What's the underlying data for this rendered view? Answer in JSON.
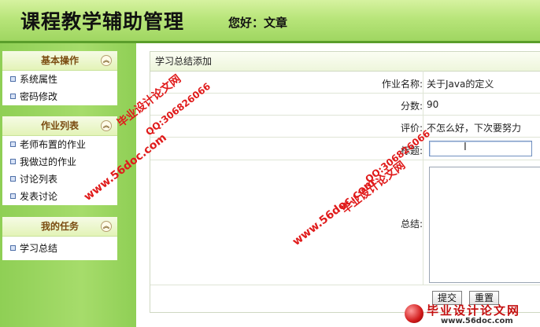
{
  "header": {
    "app_title": "课程教学辅助管理",
    "greeting": "您好：文章"
  },
  "sidebar": {
    "panels": [
      {
        "title": "基本操作",
        "items": [
          "系统属性",
          "密码修改"
        ]
      },
      {
        "title": "作业列表",
        "items": [
          "老师布置的作业",
          "我做过的作业",
          "讨论列表",
          "发表讨论"
        ]
      },
      {
        "title": "我的任务",
        "items": [
          "学习总结"
        ]
      }
    ]
  },
  "form": {
    "title": "学习总结添加",
    "rows": [
      {
        "label": "作业名称:",
        "value": "关于Java的定义"
      },
      {
        "label": "分数:",
        "value": "90"
      },
      {
        "label": "评价:",
        "value": "不怎么好，下次要努力"
      }
    ],
    "title_field": {
      "label": "标题:",
      "value": ""
    },
    "summary_field": {
      "label": "总结:",
      "value": ""
    },
    "submit_label": "提交",
    "reset_label": "重置"
  },
  "watermark": {
    "text_cn": "毕业设计论文网",
    "site": "www.56doc.com",
    "qq": "QQ:306826066"
  },
  "colors": {
    "header_green": "#b8e57a",
    "sidebar_green": "#a6dc6b",
    "panel_title": "#7a4b10",
    "watermark_red": "#e01b1b"
  }
}
